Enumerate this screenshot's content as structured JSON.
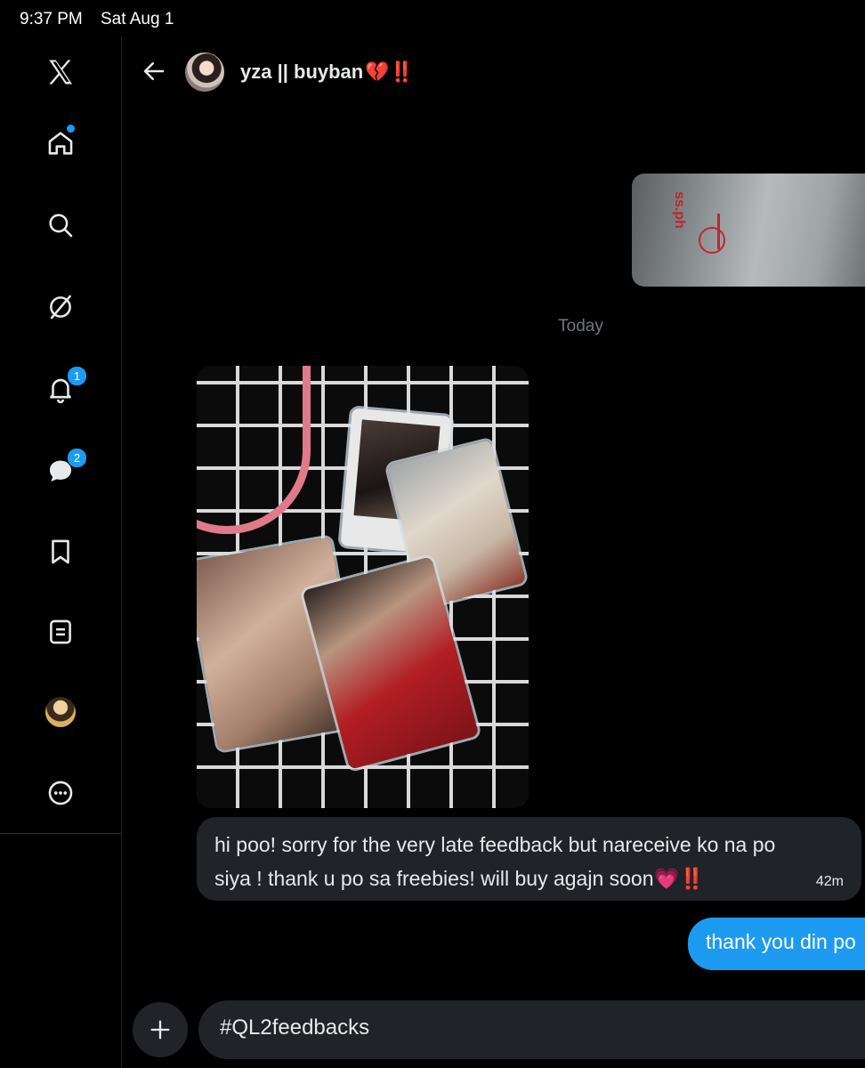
{
  "status_bar": {
    "time": "9:37 PM",
    "date": "Sat Aug 1"
  },
  "sidebar": {
    "items": [
      {
        "name": "x-logo",
        "icon": "x-logo-icon"
      },
      {
        "name": "home",
        "icon": "home-icon",
        "has_dot": true
      },
      {
        "name": "explore",
        "icon": "search-icon"
      },
      {
        "name": "grok",
        "icon": "slash-circle-icon"
      },
      {
        "name": "notifications",
        "icon": "bell-icon",
        "badge": "1"
      },
      {
        "name": "messages",
        "icon": "message-icon",
        "badge": "2"
      },
      {
        "name": "bookmarks",
        "icon": "bookmark-icon"
      },
      {
        "name": "lists",
        "icon": "list-icon"
      },
      {
        "name": "profile",
        "icon": "avatar"
      },
      {
        "name": "more",
        "icon": "more-icon"
      }
    ],
    "accent": "#1d9bf0"
  },
  "header": {
    "name": "yza || buyban",
    "emoji": "💔‼️"
  },
  "conversation": {
    "date_separator": "Today",
    "incoming_message": {
      "text": "hi poo! sorry for the very late feedback but nareceive ko na po siya ! thank u po sa freebies! will buy agajn soon",
      "emoji": "💗‼️",
      "time": "42m"
    },
    "outgoing_message": {
      "text": "thank you din po"
    },
    "top_image_text": "ss.ph"
  },
  "composer": {
    "value": "#QL2feedbacks"
  }
}
